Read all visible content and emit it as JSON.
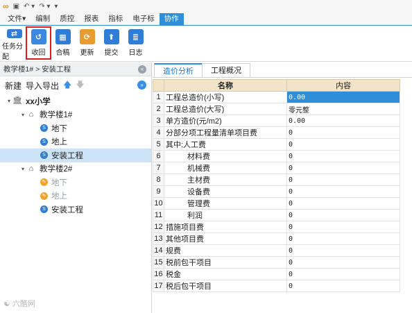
{
  "quick_access": {
    "undo": "↶ ▾",
    "redo": "↷ ▾",
    "more": "▾"
  },
  "menu": {
    "items": [
      "文件▾",
      "编制",
      "质控",
      "报表",
      "指标",
      "电子标",
      "协作"
    ],
    "active": "协作"
  },
  "ribbon": {
    "buttons": [
      {
        "label": "任务分配",
        "icon": "tasks-icon",
        "color": "#2f7dd6",
        "glyph": "⇄"
      },
      {
        "label": "收回",
        "icon": "retrieve-icon",
        "color": "#3a88e0",
        "glyph": "↺",
        "selected": true
      },
      {
        "label": "合稿",
        "icon": "merge-icon",
        "color": "#2f7dd6",
        "glyph": "▦"
      },
      {
        "label": "更新",
        "icon": "update-icon",
        "color": "#e89b2e",
        "glyph": "⟳"
      },
      {
        "label": "提交",
        "icon": "submit-icon",
        "color": "#2f7dd6",
        "glyph": "⬆"
      },
      {
        "label": "日志",
        "icon": "log-icon",
        "color": "#2f7dd6",
        "glyph": "≣"
      }
    ]
  },
  "left": {
    "breadcrumb": "教学楼1# > 安装工程",
    "collapse_icon": "«",
    "toolbar": {
      "new": "新建",
      "import_export": "导入导出",
      "up": "🡅",
      "down": "🡇",
      "expand": "»"
    },
    "tree": [
      {
        "label": "xx小学",
        "level": 0,
        "toggle": "▾",
        "icon": "school-icon",
        "glyph": "🏛",
        "color": "#555",
        "bold": true
      },
      {
        "label": "教学楼1#",
        "level": 1,
        "toggle": "▾",
        "icon": "building-icon",
        "glyph": "⌂",
        "color": "#555"
      },
      {
        "label": "地下",
        "level": 2,
        "toggle": "",
        "icon": "item-icon",
        "glyph": "S",
        "color": "#2f7dd6"
      },
      {
        "label": "地上",
        "level": 2,
        "toggle": "",
        "icon": "item-icon",
        "glyph": "S",
        "color": "#2f7dd6"
      },
      {
        "label": "安装工程",
        "level": 2,
        "toggle": "",
        "icon": "item-icon",
        "glyph": "S",
        "color": "#2f7dd6",
        "selected": true
      },
      {
        "label": "教学楼2#",
        "level": 1,
        "toggle": "▾",
        "icon": "building-icon",
        "glyph": "⌂",
        "color": "#555"
      },
      {
        "label": "地下",
        "level": 2,
        "toggle": "",
        "icon": "item-icon",
        "glyph": "✎",
        "color": "#f0a430",
        "dim": true
      },
      {
        "label": "地上",
        "level": 2,
        "toggle": "",
        "icon": "item-icon",
        "glyph": "✎",
        "color": "#f0a430",
        "dim": true
      },
      {
        "label": "安装工程",
        "level": 2,
        "toggle": "",
        "icon": "item-icon",
        "glyph": "S",
        "color": "#2f7dd6"
      }
    ]
  },
  "right": {
    "tabs": [
      "造价分析",
      "工程概况"
    ],
    "active_tab": "造价分析",
    "columns": [
      "",
      "名称",
      "内容"
    ],
    "rows": [
      {
        "no": "1",
        "name": "工程总造价(小写)",
        "value": "0.00",
        "hl": true
      },
      {
        "no": "2",
        "name": "工程总造价(大写)",
        "value": "零元整"
      },
      {
        "no": "3",
        "name": "单方造价(元/m2)",
        "value": "0.00"
      },
      {
        "no": "4",
        "name": "分部分项工程量清单项目费",
        "value": "0"
      },
      {
        "no": "5",
        "name": "其中:人工费",
        "value": "0"
      },
      {
        "no": "6",
        "name": "材料费",
        "value": "0",
        "ind": true
      },
      {
        "no": "7",
        "name": "机械费",
        "value": "0",
        "ind": true
      },
      {
        "no": "8",
        "name": "主材费",
        "value": "0",
        "ind": true
      },
      {
        "no": "9",
        "name": "设备费",
        "value": "0",
        "ind": true
      },
      {
        "no": "10",
        "name": "管理费",
        "value": "0",
        "ind": true
      },
      {
        "no": "11",
        "name": "利润",
        "value": "0",
        "ind": true
      },
      {
        "no": "12",
        "name": "措施项目费",
        "value": "0"
      },
      {
        "no": "13",
        "name": "其他项目费",
        "value": "0"
      },
      {
        "no": "14",
        "name": "规费",
        "value": "0"
      },
      {
        "no": "15",
        "name": "税前包干项目",
        "value": "0"
      },
      {
        "no": "16",
        "name": "税金",
        "value": "0"
      },
      {
        "no": "17",
        "name": "税后包干项目",
        "value": "0"
      }
    ]
  },
  "watermark": "六酷网"
}
